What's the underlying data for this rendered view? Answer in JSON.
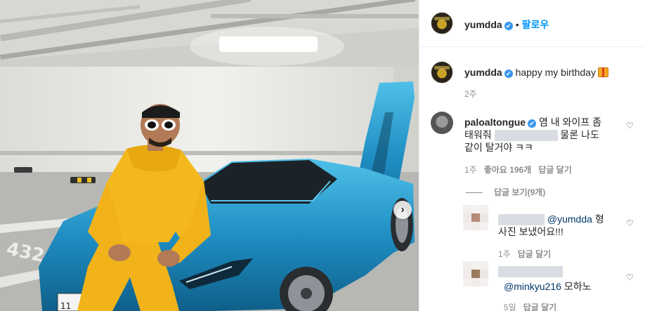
{
  "header": {
    "username": "yumdda",
    "verified_symbol": "✔",
    "dot": "•",
    "follow_label": "팔로우"
  },
  "caption": {
    "username": "yumdda",
    "text": "happy my birthday",
    "time": "2주"
  },
  "comments": [
    {
      "username": "paloaltongue",
      "line1": "염 내 와이프 좀",
      "line2_start": "태워줘",
      "line2_end": "물론 나도",
      "line3": "같이 탈거야 ㅋㅋ",
      "time": "1주",
      "likes": "좋아요 196개",
      "reply": "답글 달기",
      "view_replies": "답글 보기(9개)"
    },
    {
      "mention": "@yumdda",
      "text1": "형",
      "text2": "사진 보냈어요!!!",
      "time": "1주",
      "reply": "답글 달기"
    },
    {
      "mention": "@minkyu216",
      "text": "모하노",
      "time": "5일",
      "reply": "답글 달기"
    }
  ],
  "icons": {
    "heart": "♡",
    "next_arrow": "›"
  },
  "photo": {
    "stall_number": "432",
    "plate_text": "11"
  },
  "colors": {
    "follow_blue": "#0095f6",
    "verified_blue": "#3897f0",
    "car_blue": "#1f8fc4",
    "outfit_yellow": "#f4b81c"
  }
}
